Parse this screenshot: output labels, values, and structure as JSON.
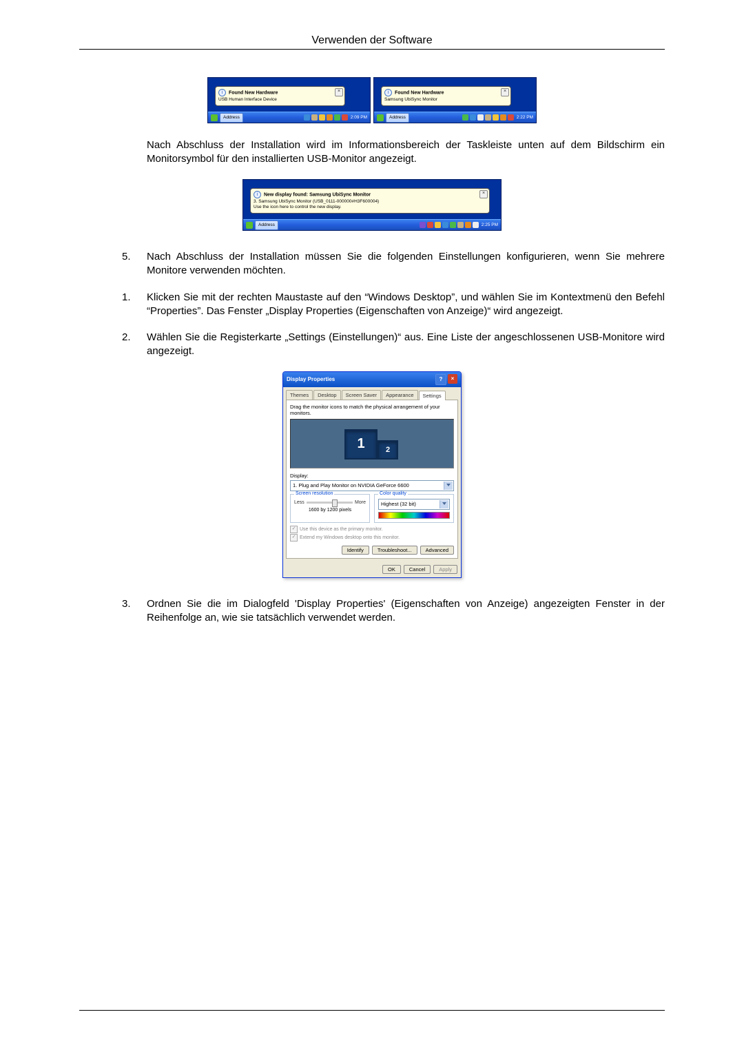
{
  "header": {
    "title": "Verwenden der Software"
  },
  "figure_notify": {
    "left": {
      "balloon_title": "Found New Hardware",
      "balloon_sub": "USB Human Interface Device",
      "taskbar_address": "Address",
      "clock": "2:09 PM"
    },
    "right": {
      "balloon_title": "Found New Hardware",
      "balloon_sub": "Samsung UbiSync Monitor",
      "taskbar_address": "Address",
      "clock": "2:22 PM"
    }
  },
  "paragraph_after_fig1": "Nach Abschluss der Installation wird im Informationsbereich der Taskleiste unten auf dem Bildschirm ein Monitorsymbol für den installierten USB-Monitor angezeigt.",
  "figure_new_display": {
    "balloon_title": "New display found: Samsung UbiSync Monitor",
    "balloon_line1": "3. Samsung UbiSync Monitor (USB_0111-000000#H3F600004)",
    "balloon_line2": "Use the icon here to control the new display.",
    "taskbar_address": "Address",
    "clock": "2:25 PM"
  },
  "step5": "Nach Abschluss der Installation müssen Sie die folgenden Einstellungen konfigurieren, wenn Sie mehrere Monitore verwenden möchten.",
  "step1": "Klicken Sie mit der rechten Maustaste auf den “Windows Desktop”, und wählen Sie im Kontextmenü den Befehl “Properties”. Das Fenster „Display Properties (Eigenschaften von Anzeige)“ wird angezeigt.",
  "step2": "Wählen Sie die Registerkarte „Settings (Einstellungen)“ aus. Eine Liste der angeschlossenen USB-Monitore wird angezeigt.",
  "dialog": {
    "title": "Display Properties",
    "tabs": [
      "Themes",
      "Desktop",
      "Screen Saver",
      "Appearance",
      "Settings"
    ],
    "active_tab": 4,
    "instruction": "Drag the monitor icons to match the physical arrangement of your monitors.",
    "display_label": "Display:",
    "display_value": "1. Plug and Play Monitor on NVIDIA GeForce 6600",
    "group_resolution": "Screen resolution",
    "res_less": "Less",
    "res_more": "More",
    "res_readout": "1600 by 1200 pixels",
    "group_quality": "Color quality",
    "quality_value": "Highest (32 bit)",
    "check_primary": "Use this device as the primary monitor.",
    "check_extend": "Extend my Windows desktop onto this monitor.",
    "btn_identify": "Identify",
    "btn_troubleshoot": "Troubleshoot...",
    "btn_advanced": "Advanced",
    "btn_ok": "OK",
    "btn_cancel": "Cancel",
    "btn_apply": "Apply"
  },
  "step3": "Ordnen Sie die im Dialogfeld 'Display Properties' (Eigenschaften von Anzeige) angezeigten Fenster in der Reihenfolge an, wie sie tatsächlich verwendet werden."
}
